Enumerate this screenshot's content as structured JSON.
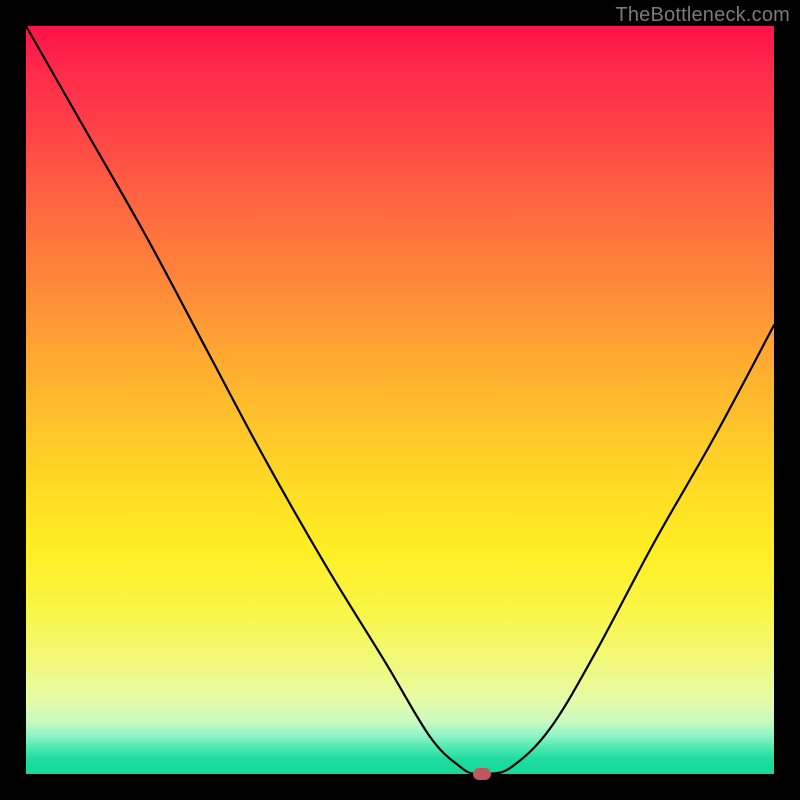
{
  "watermark": {
    "text": "TheBottleneck.com"
  },
  "chart_data": {
    "type": "line",
    "title": "",
    "xlabel": "",
    "ylabel": "",
    "xlim": [
      0,
      100
    ],
    "ylim": [
      0,
      100
    ],
    "series": [
      {
        "name": "bottleneck-curve",
        "x": [
          0,
          8,
          16,
          24,
          32,
          40,
          48,
          54,
          58,
          60,
          62,
          65,
          70,
          76,
          84,
          92,
          100
        ],
        "values": [
          100,
          86,
          72,
          57,
          42,
          28,
          15,
          5,
          1,
          0,
          0,
          1,
          6,
          16,
          31,
          45,
          60
        ]
      }
    ],
    "marker": {
      "x": 61,
      "y": 0
    },
    "gradient_stops": [
      {
        "pos": 0,
        "color": "#ff1249"
      },
      {
        "pos": 50,
        "color": "#ffc62a"
      },
      {
        "pos": 80,
        "color": "#f4f85e"
      },
      {
        "pos": 100,
        "color": "#14d99a"
      }
    ]
  }
}
